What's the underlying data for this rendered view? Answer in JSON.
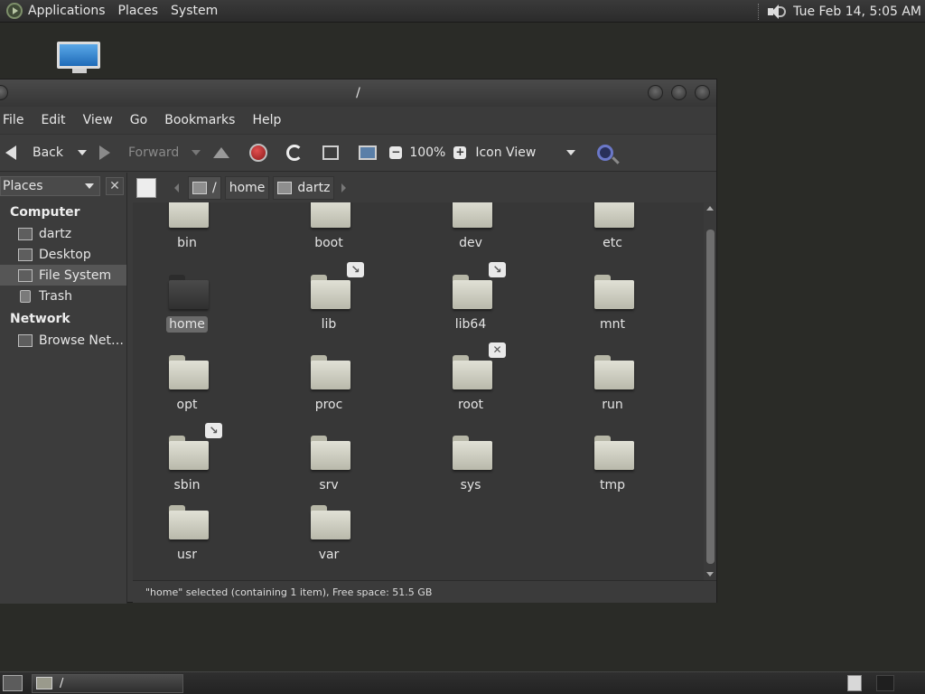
{
  "top_panel": {
    "menus": [
      "Applications",
      "Places",
      "System"
    ],
    "clock": "Tue Feb 14,  5:05 AM"
  },
  "window": {
    "title": "/",
    "menu": [
      "File",
      "Edit",
      "View",
      "Go",
      "Bookmarks",
      "Help"
    ],
    "toolbar": {
      "back_label": "Back",
      "forward_label": "Forward",
      "zoom_level": "100%",
      "view_mode": "Icon View"
    },
    "sidebar": {
      "selector_label": "Places",
      "sections": [
        {
          "title": "Computer",
          "items": [
            "dartz",
            "Desktop",
            "File System",
            "Trash"
          ]
        },
        {
          "title": "Network",
          "items": [
            "Browse Net…"
          ]
        }
      ],
      "selected": "File System"
    },
    "path": [
      "/",
      "home",
      "dartz"
    ],
    "files": [
      {
        "name": "bin",
        "emblem": "link"
      },
      {
        "name": "boot"
      },
      {
        "name": "dev"
      },
      {
        "name": "etc"
      },
      {
        "name": "home",
        "selected": true
      },
      {
        "name": "lib",
        "emblem": "link"
      },
      {
        "name": "lib64",
        "emblem": "link"
      },
      {
        "name": "mnt"
      },
      {
        "name": "opt"
      },
      {
        "name": "proc"
      },
      {
        "name": "root",
        "emblem": "no-access"
      },
      {
        "name": "run"
      },
      {
        "name": "sbin",
        "emblem": "link"
      },
      {
        "name": "srv"
      },
      {
        "name": "sys"
      },
      {
        "name": "tmp"
      },
      {
        "name": "usr"
      },
      {
        "name": "var"
      }
    ],
    "status": "\"home\" selected (containing 1 item), Free space: 51.5 GB"
  },
  "taskbar": {
    "task_label": "/"
  }
}
